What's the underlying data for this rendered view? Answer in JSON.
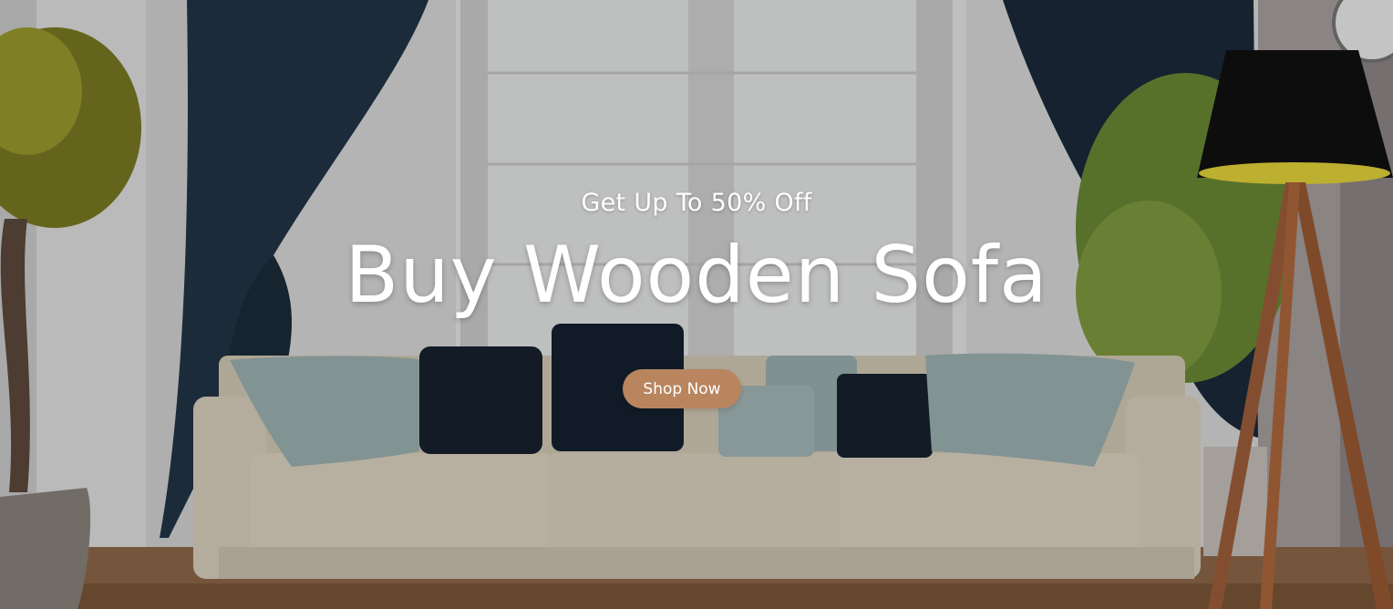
{
  "hero": {
    "subtitle": "Get Up To 50% Off",
    "title": "Buy Wooden Sofa",
    "cta_label": "Shop Now"
  },
  "colors": {
    "cta_background": "#b9855f",
    "cta_text": "#ffffff",
    "heading_text": "#ffffff",
    "curtain": "#223546",
    "sofa": "#dcd2bf",
    "pillow_dark": "#16222f",
    "pillow_light": "#9fb4b4",
    "floor": "#8f6a4b",
    "lamp_shade": "#111111",
    "lamp_glow": "#e7d63a",
    "lamp_legs": "#a0603a"
  },
  "background_image": {
    "icon": "living-room-sofa-scene"
  }
}
